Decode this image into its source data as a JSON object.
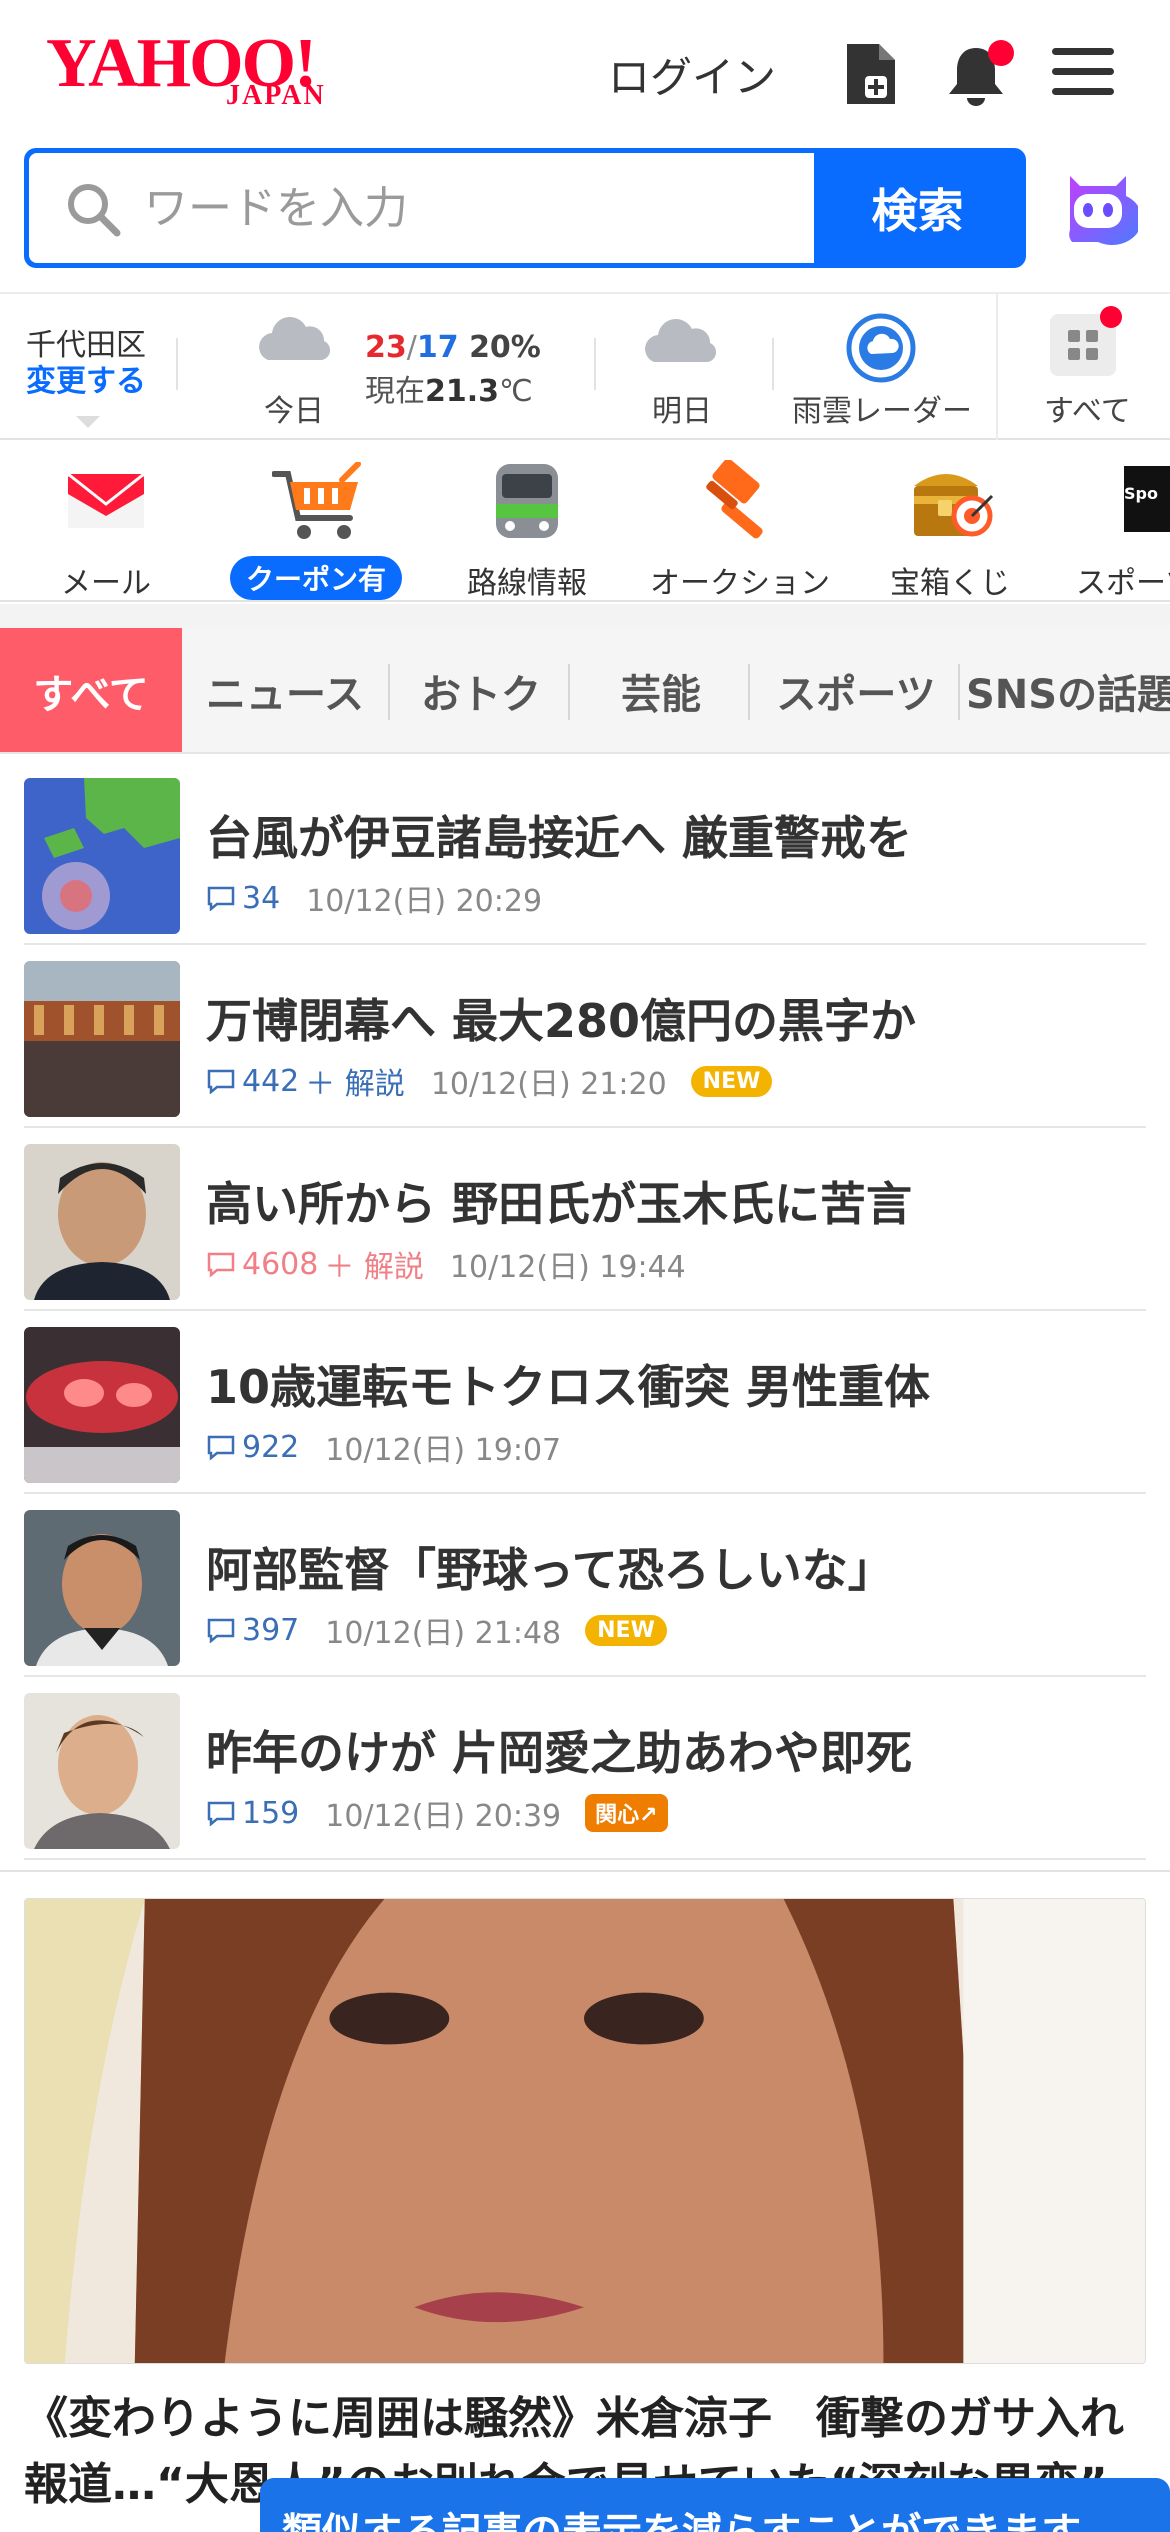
{
  "header": {
    "logo_main": "YAHOO!",
    "logo_sub": "JAPAN",
    "login_label": "ログイン",
    "brand_color": "#ff0033"
  },
  "search": {
    "placeholder": "ワードを入力",
    "button_label": "検索",
    "accent_color": "#0a6cff"
  },
  "weather": {
    "area_name": "千代田区",
    "area_change": "変更する",
    "today_label": "今日",
    "high": "23",
    "slash": "/",
    "low": "17",
    "rain": "20%",
    "now_prefix": "現在",
    "now_temp": "21.3",
    "now_unit": "℃",
    "tomorrow_label": "明日",
    "radar_label": "雨雲レーダー",
    "all_label": "すべて"
  },
  "services": [
    {
      "label": "メール",
      "icon": "mail-icon"
    },
    {
      "label": "クーポン有",
      "icon": "shopping-cart-icon"
    },
    {
      "label": "路線情報",
      "icon": "train-icon"
    },
    {
      "label": "オークション",
      "icon": "gavel-icon"
    },
    {
      "label": "宝箱くじ",
      "icon": "treasure-box-icon"
    },
    {
      "label": "スポーツ",
      "icon": "sports-icon"
    }
  ],
  "tabs": [
    {
      "label": "すべて",
      "active": true
    },
    {
      "label": "ニュース"
    },
    {
      "label": "おトク"
    },
    {
      "label": "芸能"
    },
    {
      "label": "スポーツ"
    },
    {
      "label": "SNSの話題"
    }
  ],
  "news": [
    {
      "title": "台風が伊豆諸島接近へ 厳重警戒を",
      "comments": "34",
      "commentary": "",
      "time": "10/12(日) 20:29",
      "badge": ""
    },
    {
      "title": "万博閉幕へ 最大280億円の黒字か",
      "comments": "442",
      "commentary": "＋ 解説",
      "time": "10/12(日) 21:20",
      "badge": "NEW"
    },
    {
      "title": "高い所から 野田氏が玉木氏に苦言",
      "comments": "4608",
      "commentary": "＋ 解説",
      "time": "10/12(日) 19:44",
      "badge": ""
    },
    {
      "title": "10歳運転モトクロス衝突 男性重体",
      "comments": "922",
      "commentary": "",
      "time": "10/12(日) 19:07",
      "badge": ""
    },
    {
      "title": "阿部監督「野球って恐ろしいな」",
      "comments": "397",
      "commentary": "",
      "time": "10/12(日) 21:48",
      "badge": "NEW"
    },
    {
      "title": "昨年のけが 片岡愛之助あわや即死",
      "comments": "159",
      "commentary": "",
      "time": "10/12(日) 20:39",
      "badge": "関心↗"
    }
  ],
  "feature": {
    "title": "《変わりように周囲は騒然》米倉涼子　衝撃のガサ入れ報道…“大恩人”のお別れ会で見せていた“深刻な異変”"
  },
  "toast": {
    "text": "類似する記事の表示を減らすことができます"
  }
}
